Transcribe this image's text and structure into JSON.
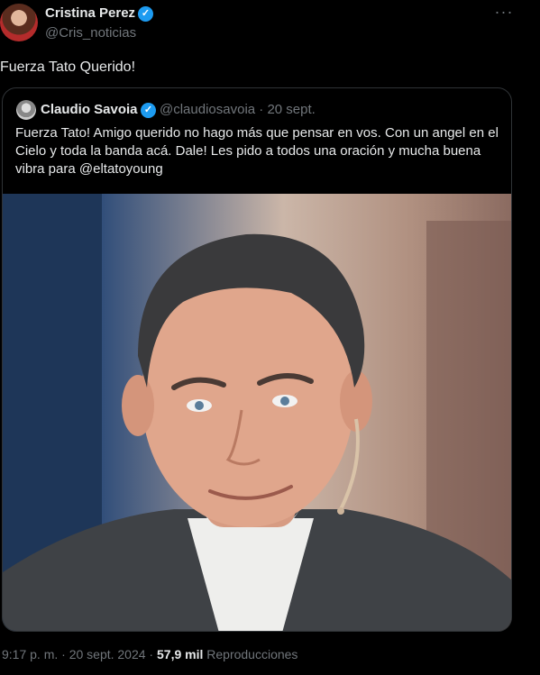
{
  "tweet": {
    "author_name": "Cristina Perez",
    "author_handle": "@Cris_noticias",
    "text": "Fuerza Tato Querido!",
    "more_label": "···"
  },
  "quote": {
    "author_name": "Claudio Savoia",
    "author_handle": "@claudiosavoia · 20 sept.",
    "text": "Fuerza Tato! Amigo querido no hago más que pensar en vos. Con un angel en el Cielo y toda la banda acá. Dale! Les pido a todos una oración y mucha buena vibra para @eltatoyoung"
  },
  "meta": {
    "timestamp": "9:17 p. m. · 20 sept. 2024 · ",
    "views_count": "57,9 mil",
    "views_label": " Reproducciones"
  },
  "icons": [
    "verified-badge-icon",
    "more-options-icon"
  ],
  "colors": {
    "background": "#000000",
    "text": "#e7e9ea",
    "secondary": "#71767b",
    "verified": "#1d9bf0",
    "border": "#2f3336"
  }
}
